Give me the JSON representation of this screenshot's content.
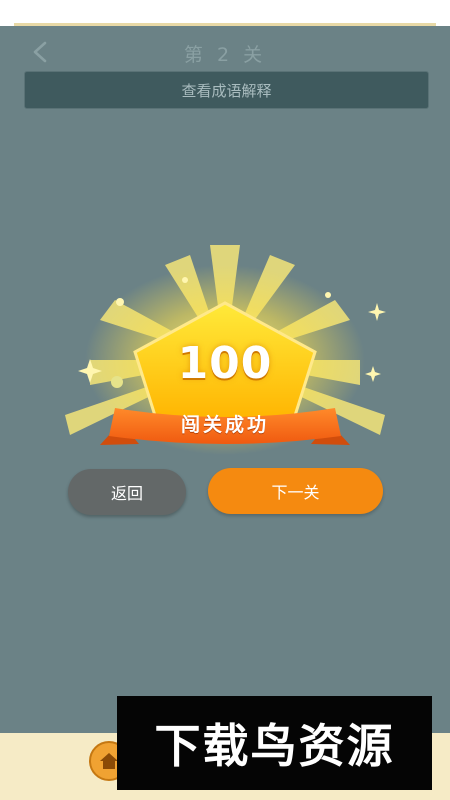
{
  "nav": {
    "title": "第 2 关"
  },
  "explain_bar": {
    "label": "查看成语解释"
  },
  "result": {
    "score": "100",
    "banner": "闯关成功"
  },
  "buttons": {
    "back": "返回",
    "next": "下一关"
  },
  "watermark": {
    "text": "下载鸟资源"
  },
  "colors": {
    "background": "#6b8286",
    "accent_orange": "#f58a10",
    "gold": "#ffd21f",
    "bottom_bar": "#f6ebc6"
  },
  "icons": [
    "back-chevron-icon",
    "home-icon"
  ]
}
